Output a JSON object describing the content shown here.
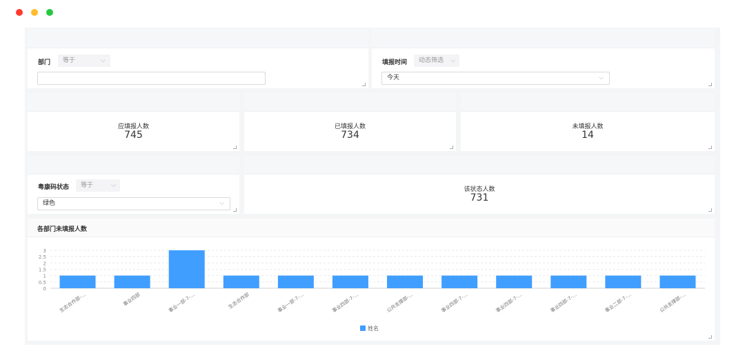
{
  "window": {
    "dots": [
      {
        "name": "close-dot",
        "color": "#ff3b30"
      },
      {
        "name": "minimize-dot",
        "color": "#ffbd2e"
      },
      {
        "name": "maximize-dot",
        "color": "#28c840"
      }
    ]
  },
  "filters": {
    "department": {
      "label": "部门",
      "operator": "等于",
      "value": ""
    },
    "fill_time": {
      "label": "填报时间",
      "operator": "动态筛选",
      "value": "今天"
    },
    "health_code": {
      "label": "粤康码状态",
      "operator": "等于",
      "value": "绿色"
    }
  },
  "kpis": {
    "should_fill": {
      "label": "应填报人数",
      "value": "745"
    },
    "filled": {
      "label": "已填报人数",
      "value": "734"
    },
    "not_filled": {
      "label": "未填报人数",
      "value": "14"
    },
    "status_count": {
      "label": "该状态人数",
      "value": "731"
    }
  },
  "chart": {
    "title": "各部门未填报人数",
    "legend_label": "姓名",
    "accent": "#409eff"
  },
  "chart_data": {
    "type": "bar",
    "title": "各部门未填报人数",
    "categories": [
      "生态合作部-...",
      "事业四部",
      "事业一部-7-...",
      "生态合作部",
      "事业一部-7-...",
      "事业四部-7-...",
      "公共支撑部-...",
      "事业四部-7-...",
      "事业四部-7-...",
      "事业四部-7-...",
      "事业二部-7-...",
      "公共支撑部-..."
    ],
    "series": [
      {
        "name": "姓名",
        "values": [
          1,
          1,
          3,
          1,
          1,
          1,
          1,
          1,
          1,
          1,
          1,
          1
        ]
      }
    ],
    "yticks": [
      "0",
      "0.5",
      "1",
      "1.5",
      "2",
      "2.5",
      "3"
    ],
    "ylim": [
      0,
      3
    ],
    "xlabel": "",
    "ylabel": "",
    "legend": "bottom-center",
    "grid": true
  }
}
